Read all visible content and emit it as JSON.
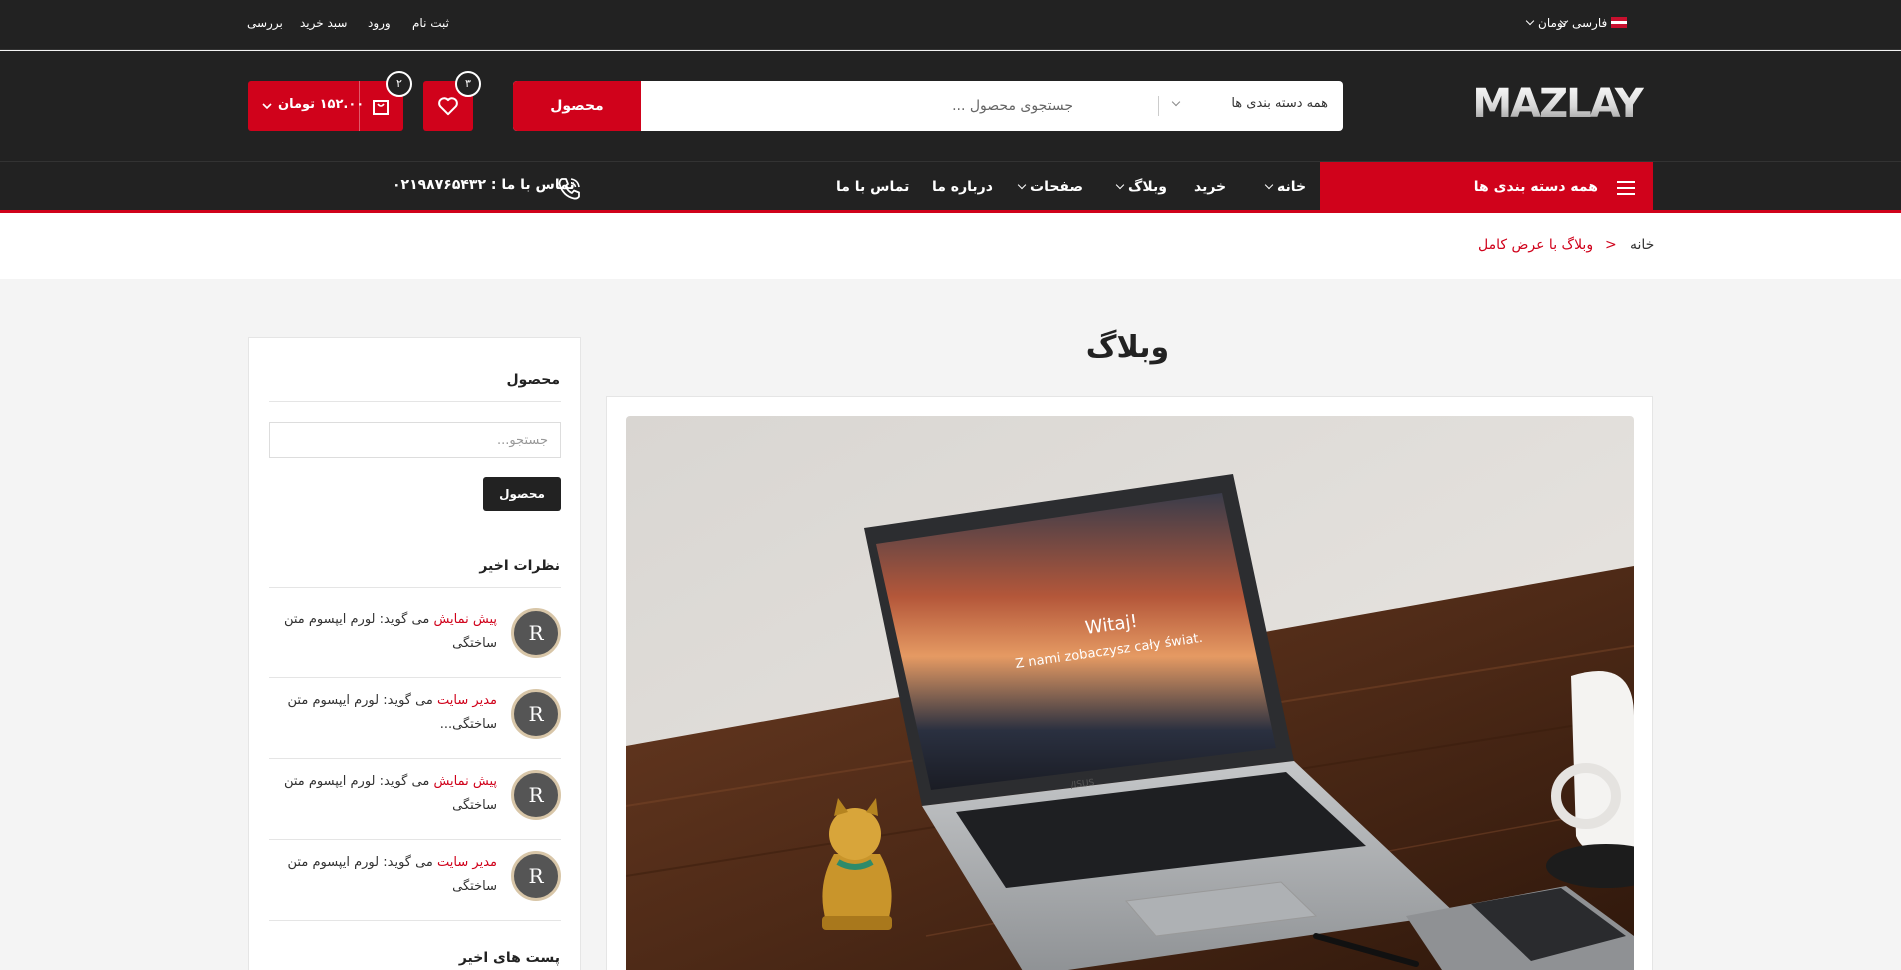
{
  "topbar": {
    "language": "فارسی",
    "currency": "تومان",
    "links": [
      "ثبت نام",
      "ورود",
      "سبد خرید",
      "بررسی"
    ]
  },
  "header": {
    "logo_text": "MAZLAY",
    "search": {
      "button_label": "محصول",
      "placeholder": "جستجوی محصول ...",
      "category_label": "همه دسته بندی ها"
    },
    "wishlist_count": "۳",
    "cart_count": "۲",
    "cart_total": "۱۵۲.۰۰ تومان"
  },
  "nav": {
    "all_categories": "همه دسته بندی ها",
    "items": [
      "خانه",
      "خرید",
      "وبلاگ",
      "صفحات",
      "درباره ما",
      "تماس با ما"
    ],
    "contact": "تماس با ما : ۰۲۱۹۸۷۶۵۴۳۲"
  },
  "breadcrumb": {
    "home": "خانه",
    "separator": ">",
    "current": "وبلاگ با عرض کامل"
  },
  "page": {
    "title": "وبلاگ"
  },
  "post_image": {
    "screen_title": "Witaj!",
    "screen_subtitle": "Z nami zobaczysz cały świat.",
    "brand": "/ISUS"
  },
  "sidebar": {
    "search_title": "محصول",
    "search_placeholder": "جستجو...",
    "search_button": "محصول",
    "comments_title": "نظرات اخیر",
    "comments": [
      {
        "avatar": "R",
        "author": "پیش نمایش",
        "says": " می گوید: ",
        "text": "لورم ایپسوم متن ساختگی"
      },
      {
        "avatar": "R",
        "author": "مدیر سایت",
        "says": " می گوید: ",
        "text": "لورم ایپسوم متن ساختگی..."
      },
      {
        "avatar": "R",
        "author": "پیش نمایش",
        "says": " می گوید: ",
        "text": "لورم ایپسوم متن ساختگی"
      },
      {
        "avatar": "R",
        "author": "مدیر سایت",
        "says": " می گوید: ",
        "text": "لورم ایپسوم متن ساختگی"
      }
    ],
    "recent_posts_title": "پست های اخیر"
  },
  "colors": {
    "accent": "#d0021b",
    "dark": "#222222"
  }
}
